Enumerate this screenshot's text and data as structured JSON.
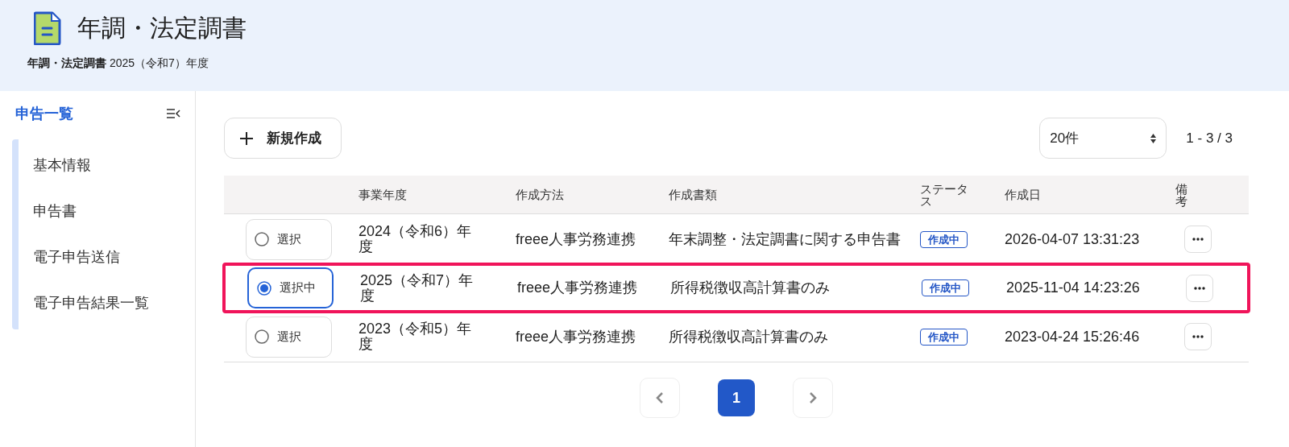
{
  "header": {
    "title": "年調・法定調書",
    "breadcrumb": "**年調・法定調書** 2025（令和7）年度"
  },
  "sidebar": {
    "title": "申告一覧",
    "items": [
      {
        "label": "基本情報"
      },
      {
        "label": "申告書"
      },
      {
        "label": "電子申告送信"
      },
      {
        "label": "電子申告結果一覧"
      }
    ]
  },
  "toolbar": {
    "new_button": "新規作成",
    "page_size": "20件",
    "range": "1 - 3 / 3"
  },
  "table": {
    "columns": [
      "事業年度",
      "作成方法",
      "作成書類",
      "ステータス",
      "作成日",
      "備考"
    ],
    "rows": [
      {
        "selected": false,
        "select_label": "選択",
        "year": "2024（令和6）年度",
        "method": "freee人事労務連携",
        "document": "年末調整・法定調書に関する申告書",
        "status": "作成中",
        "created": "2026-04-07 13:31:23"
      },
      {
        "selected": true,
        "select_label": "選択中",
        "year": "2025（令和7）年度",
        "method": "freee人事労務連携",
        "document": "所得税徴収高計算書のみ",
        "status": "作成中",
        "created": "2025-11-04 14:23:26"
      },
      {
        "selected": false,
        "select_label": "選択",
        "year": "2023（令和5）年度",
        "method": "freee人事労務連携",
        "document": "所得税徴収高計算書のみ",
        "status": "作成中",
        "created": "2023-04-24 15:26:46"
      }
    ]
  },
  "pagination": {
    "pages": [
      {
        "label": "1",
        "selected": true
      }
    ]
  }
}
